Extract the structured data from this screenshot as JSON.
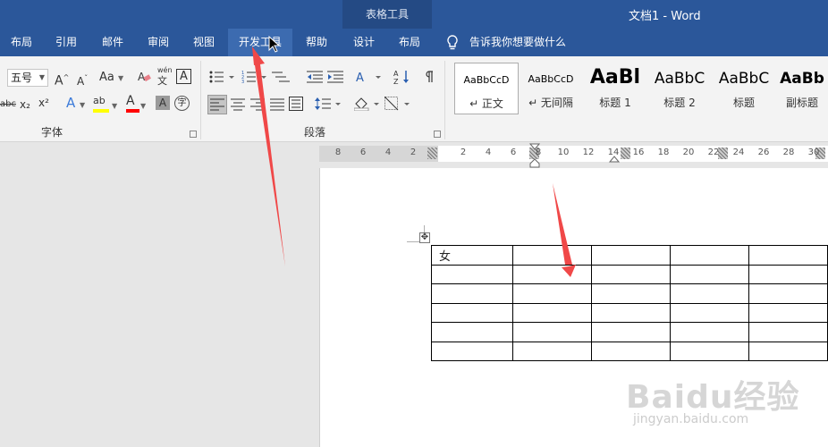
{
  "titlebar": {
    "context_group": "表格工具",
    "doc_title": "文档1  -  Word"
  },
  "tabs": [
    {
      "label": "布局",
      "active": false
    },
    {
      "label": "引用",
      "active": false
    },
    {
      "label": "邮件",
      "active": false
    },
    {
      "label": "审阅",
      "active": false
    },
    {
      "label": "视图",
      "active": false
    },
    {
      "label": "开发工具",
      "active": true
    },
    {
      "label": "帮助",
      "active": false
    },
    {
      "label": "设计",
      "active": false
    },
    {
      "label": "布局",
      "active": false
    }
  ],
  "tellme": {
    "text": "告诉我你想要做什么"
  },
  "font_group": {
    "label": "字体",
    "font_size": "五号",
    "grow_font": "A",
    "shrink_font": "A",
    "change_case": "Aa",
    "phonetic_top": "wén",
    "phonetic_bottom": "文",
    "char_border": "A",
    "strikethrough": "abc",
    "subscript": "x₂",
    "superscript": "x²",
    "text_effect": "A",
    "highlight": "ab",
    "font_color": "A",
    "char_shading": "A",
    "enclose_char": "字"
  },
  "paragraph_group": {
    "label": "段落"
  },
  "styles": [
    {
      "sample": "AaBbCcD",
      "name": "↵ 正文",
      "size": 11,
      "bold": false,
      "selected": true
    },
    {
      "sample": "AaBbCcD",
      "name": "↵ 无间隔",
      "size": 11,
      "bold": false,
      "selected": false
    },
    {
      "sample": "AaBl",
      "name": "标题 1",
      "size": 22,
      "bold": true,
      "selected": false
    },
    {
      "sample": "AaBbC",
      "name": "标题 2",
      "size": 17,
      "bold": false,
      "selected": false
    },
    {
      "sample": "AaBbC",
      "name": "标题",
      "size": 17,
      "bold": false,
      "selected": false
    },
    {
      "sample": "AaBb",
      "name": "副标题",
      "size": 17,
      "bold": false,
      "selected": false
    }
  ],
  "ruler": {
    "ticks": [
      "8",
      "6",
      "4",
      "2",
      "2",
      "4",
      "6",
      "8",
      "10",
      "12",
      "14",
      "16",
      "18",
      "20",
      "22",
      "24",
      "26",
      "28",
      "30"
    ]
  },
  "table": {
    "rows": [
      [
        "女",
        "",
        "",
        "",
        ""
      ],
      [
        "",
        "",
        "",
        "",
        ""
      ],
      [
        "",
        "",
        "",
        "",
        ""
      ],
      [
        "",
        "",
        "",
        "",
        ""
      ],
      [
        "",
        "",
        "",
        "",
        ""
      ],
      [
        "",
        "",
        "",
        "",
        ""
      ]
    ]
  },
  "watermark": {
    "logo": "Baidu经验",
    "url": "jingyan.baidu.com"
  },
  "colors": {
    "titlebar": "#2b579a",
    "ribbon": "#f3f3f3",
    "arrow": "#f04848",
    "highlight": "#ffff00",
    "font_color": "#ff0000"
  }
}
